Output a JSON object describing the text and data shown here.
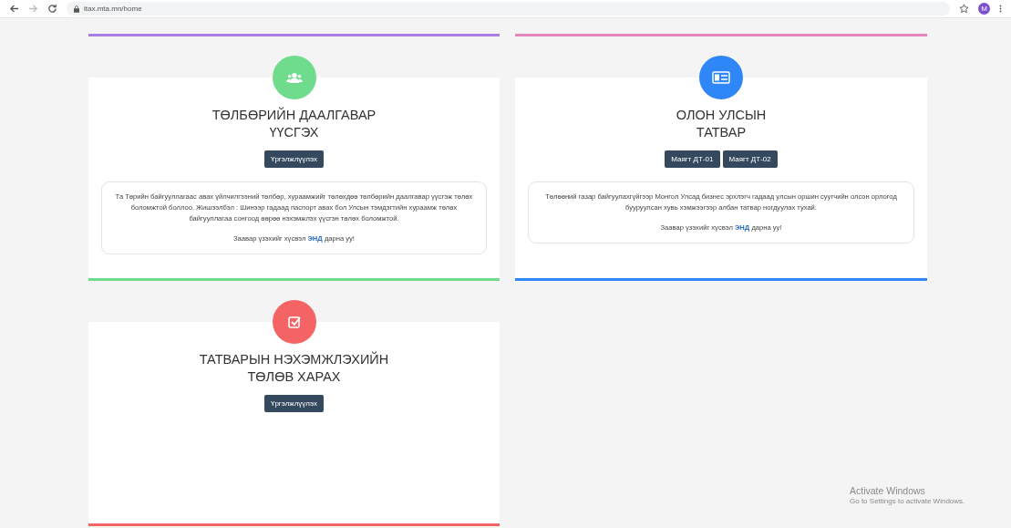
{
  "browser": {
    "url": "itax.mta.mn/home",
    "avatar_letter": "M"
  },
  "cards_above": [
    {
      "color": "#a97fe3"
    },
    {
      "color": "#e684bd"
    }
  ],
  "cards": [
    {
      "kind": "people",
      "color": "#6edc8c",
      "title_lines": [
        "ТӨЛБӨРИЙН ДААЛГАВАР",
        "ҮҮСГЭХ"
      ],
      "buttons": [
        "Үргэлжлүүлэх"
      ],
      "description": {
        "text": "Та Төрийн байгууллагаас авах үйлчилгээний төлбөр, хураамжийг төлөхдөө төлбөрийн даалгавар үүсгэж төлөх боломжтой боллоо. Жишээлбэл : Шинээр гадаад паспорт авах бол Улсын тэмдэгтийн хураамж төлөх байгууллагаа сонгоод өөрөө нэхэмжлэх үүсгэн төлөх боломжтой.",
        "before_link": "Заавар үзэхийг хүсвэл",
        "link": "ЭНД",
        "after_link": "дарна уу!"
      }
    },
    {
      "kind": "money",
      "color": "#2f86f6",
      "title_lines": [
        "ОЛОН УЛСЫН",
        "ТАТВАР"
      ],
      "buttons": [
        "Маягт ДТ-01",
        "Маягт ДТ-02"
      ],
      "description": {
        "text": "Төлөөний газар байгуулахгүйгээр Монгол Улсад бизнес эрхлэгч гадаад улсын оршин суугчийн олсон орлогод бууруулсан хувь хэмжээгээр албан татвар ногдуулах тухай.",
        "before_link": "Заавар үзэхийг хүсвэл",
        "link": "ЭНД",
        "after_link": "дарна уу!"
      }
    },
    {
      "kind": "check",
      "color": "#f56464",
      "title_lines": [
        "ТАТВАРЫН НЭХЭМЖЛЭХИЙН",
        "ТӨЛӨВ ХАРАХ"
      ],
      "buttons": [
        "Үргэлжлүүлэх"
      ]
    }
  ],
  "os_notice": {
    "title": "Activate Windows",
    "subtitle": "Go to Settings to activate Windows."
  }
}
